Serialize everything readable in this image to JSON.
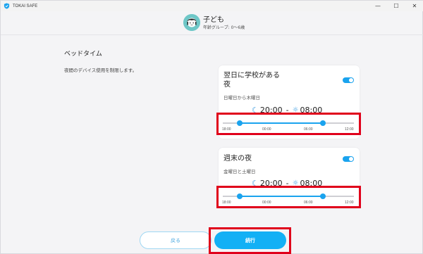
{
  "window": {
    "title": "TOKAI SAFE",
    "controls": [
      "—",
      "☐",
      "✕"
    ]
  },
  "profile": {
    "name": "子ども",
    "age_group": "年齢グループ: 0～6歳"
  },
  "section": {
    "title": "ベッドタイム",
    "description": "夜間のデバイス使用を制限します。"
  },
  "cards": [
    {
      "title_line1": "翌日に学校がある",
      "title_line2": "夜",
      "subtitle": "日曜日から木曜日",
      "enabled": true,
      "start_time": "20:00",
      "separator": "-",
      "end_time": "08:00",
      "ticks": [
        "18:00",
        "00:00",
        "06:00",
        "12:00"
      ],
      "range_fraction": [
        0.111,
        0.583
      ]
    },
    {
      "title_line1": "週末の夜",
      "title_line2": "",
      "subtitle": "金曜日と土曜日",
      "enabled": true,
      "start_time": "20:00",
      "separator": "-",
      "end_time": "08:00",
      "ticks": [
        "18:00",
        "00:00",
        "06:00",
        "12:00"
      ],
      "range_fraction": [
        0.111,
        0.583
      ]
    }
  ],
  "buttons": {
    "back": "戻る",
    "continue": "続行"
  },
  "colors": {
    "accent": "#13b0f5",
    "highlight": "#e0001b"
  }
}
